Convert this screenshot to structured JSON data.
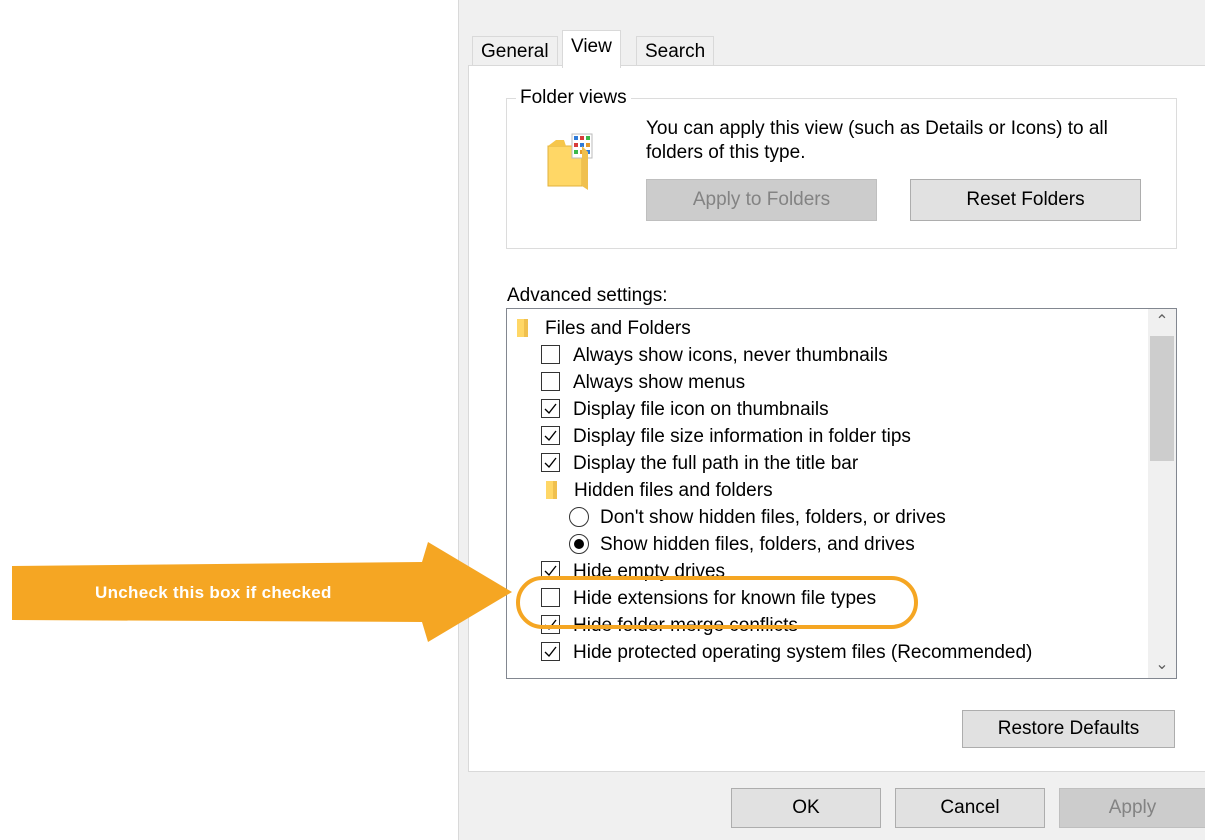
{
  "tabs": [
    {
      "label": "General",
      "active": false
    },
    {
      "label": "View",
      "active": true
    },
    {
      "label": "Search",
      "active": false
    }
  ],
  "folder_views": {
    "legend": "Folder views",
    "description": "You can apply this view (such as Details or Icons) to all folders of this type.",
    "apply_label": "Apply to Folders",
    "reset_label": "Reset Folders"
  },
  "advanced": {
    "label": "Advanced settings:",
    "items": [
      {
        "type": "folder",
        "label": "Files and Folders"
      },
      {
        "type": "checkbox",
        "label": "Always show icons, never thumbnails",
        "checked": false
      },
      {
        "type": "checkbox",
        "label": "Always show menus",
        "checked": false
      },
      {
        "type": "checkbox",
        "label": "Display file icon on thumbnails",
        "checked": true
      },
      {
        "type": "checkbox",
        "label": "Display file size information in folder tips",
        "checked": true
      },
      {
        "type": "checkbox",
        "label": "Display the full path in the title bar",
        "checked": true
      },
      {
        "type": "folder",
        "label": "Hidden files and folders"
      },
      {
        "type": "radio",
        "label": "Don't show hidden files, folders, or drives",
        "selected": false
      },
      {
        "type": "radio",
        "label": "Show hidden files, folders, and drives",
        "selected": true
      },
      {
        "type": "checkbox",
        "label": "Hide empty drives",
        "checked": true
      },
      {
        "type": "checkbox",
        "label": "Hide extensions for known file types",
        "checked": false
      },
      {
        "type": "checkbox",
        "label": "Hide folder merge conflicts",
        "checked": true
      },
      {
        "type": "checkbox",
        "label": "Hide protected operating system files (Recommended)",
        "checked": true
      }
    ]
  },
  "restore_label": "Restore Defaults",
  "footer": {
    "ok": "OK",
    "cancel": "Cancel",
    "apply": "Apply"
  },
  "callout": {
    "text": "Uncheck this box if checked",
    "color": "#f5a623"
  },
  "colors": {
    "dialog_bg": "#f0f0f0",
    "folder_yellow": "#ffd766",
    "disabled_btn": "#cccccc"
  }
}
